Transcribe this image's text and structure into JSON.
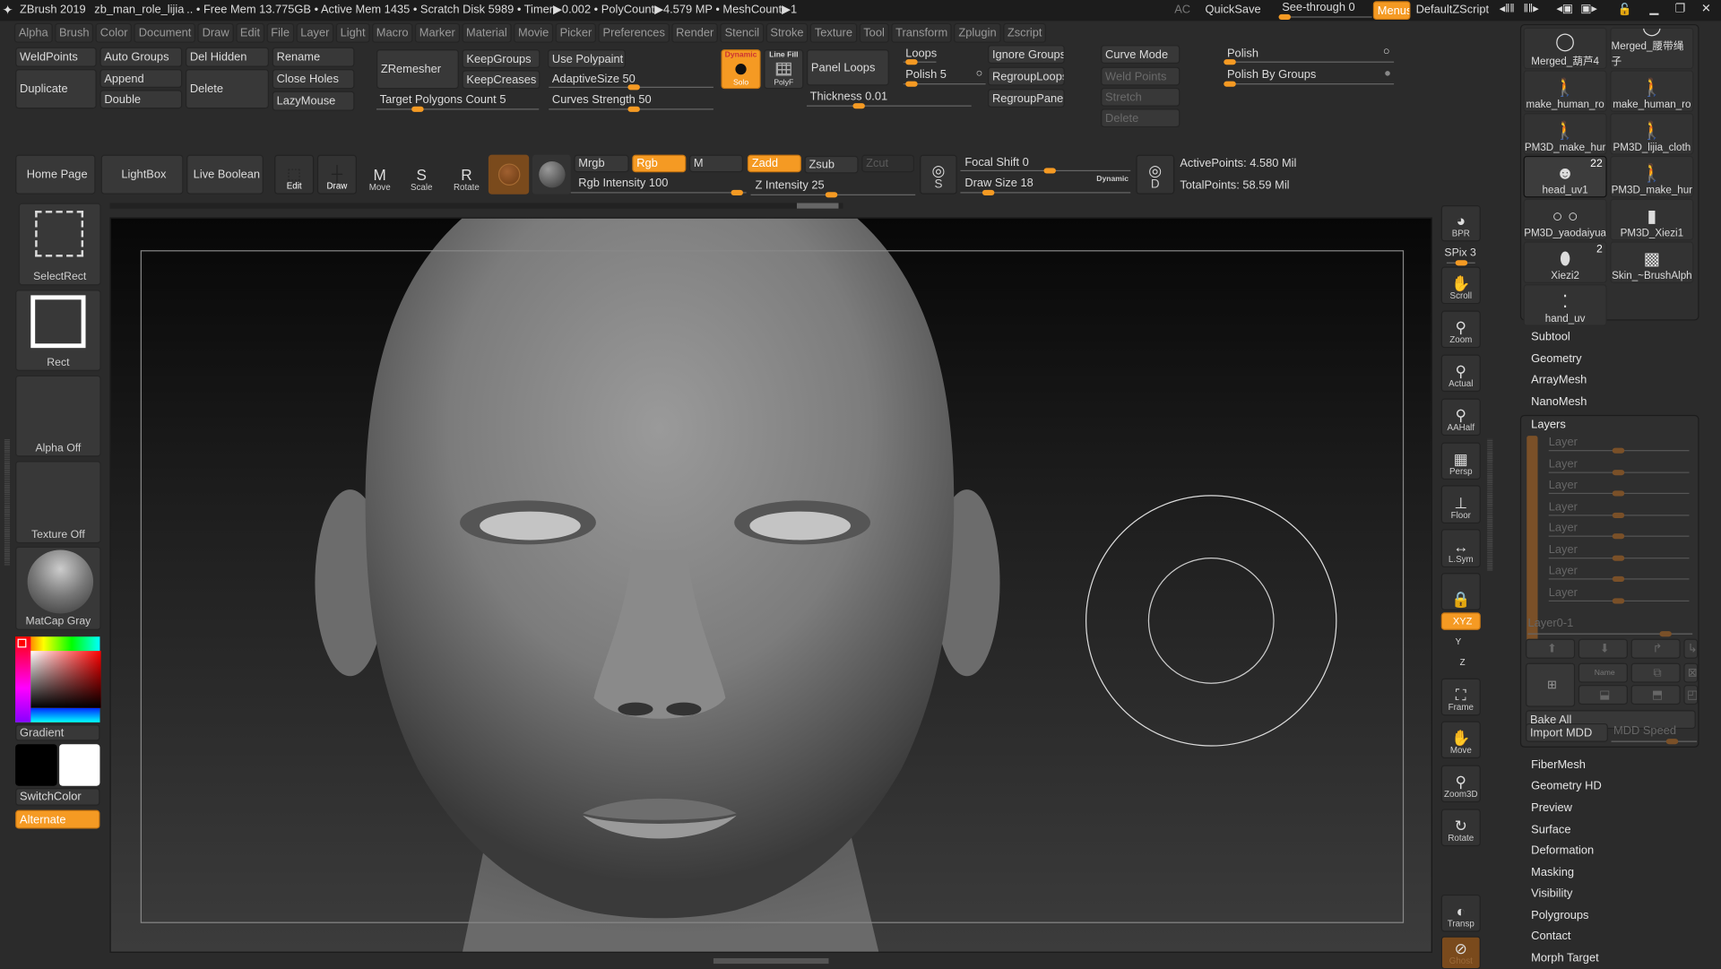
{
  "title_bar": {
    "app": "ZBrush 2019",
    "file": "zb_man_role_lijia",
    "status": ".. • Free Mem 13.775GB • Active Mem 1435 • Scratch Disk 5989 •  Timer▶0.002 • PolyCount▶4.579 MP  • MeshCount▶1",
    "ac": "AC",
    "quicksave": "QuickSave",
    "see_through": "See-through  0",
    "menus": "Menus",
    "default_zscript": "DefaultZScript"
  },
  "menu": [
    "Alpha",
    "Brush",
    "Color",
    "Document",
    "Draw",
    "Edit",
    "File",
    "Layer",
    "Light",
    "Macro",
    "Marker",
    "Material",
    "Movie",
    "Picker",
    "Preferences",
    "Render",
    "Stencil",
    "Stroke",
    "Texture",
    "Tool",
    "Transform",
    "Zplugin",
    "Zscript"
  ],
  "toolbar1": {
    "weldpoints": "WeldPoints",
    "duplicate": "Duplicate",
    "auto_groups": "Auto Groups",
    "append": "Append",
    "double": "Double",
    "del_hidden": "Del Hidden",
    "delete": "Delete",
    "rename": "Rename",
    "close_holes": "Close Holes",
    "lazymouse": "LazyMouse",
    "zremesher": "ZRemesher",
    "keepgroups": "KeepGroups",
    "keepcreases": "KeepCreases",
    "target_polygons": "Target Polygons Count 5",
    "use_polypaint": "Use Polypaint",
    "adaptive_size": "AdaptiveSize 50",
    "curves_strength": "Curves Strength 50",
    "solo_top": "Dynamic",
    "solo": "Solo",
    "linefill": "Line Fill",
    "polyf": "PolyF",
    "panel_loops": "Panel Loops",
    "loops": "Loops",
    "polish": "Polish 5",
    "thickness": "Thickness 0.01",
    "ignore_groups": "Ignore Groups",
    "regroup_loops": "RegroupLoops",
    "regroup_panels": "RegroupPanels",
    "curve_mode": "Curve Mode",
    "weld_points": "Weld Points",
    "stretch": "Stretch",
    "delete2": "Delete",
    "polish_r": "Polish",
    "polish_by_groups": "Polish By Groups"
  },
  "toolbar2": {
    "home_page": "Home Page",
    "lightbox": "LightBox",
    "live_boolean": "Live Boolean",
    "edit": "Edit",
    "draw": "Draw",
    "move": "Move",
    "scale": "Scale",
    "rotate": "Rotate",
    "mrgb": "Mrgb",
    "rgb": "Rgb",
    "m": "M",
    "zadd": "Zadd",
    "zsub": "Zsub",
    "zcut": "Zcut",
    "rgb_intensity": "Rgb Intensity 100",
    "z_intensity": "Z Intensity 25",
    "focal_shift": "Focal Shift 0",
    "draw_size": "Draw Size 18",
    "dynamic": "Dynamic",
    "s": "S",
    "d": "D",
    "active_points": "ActivePoints: 4.580 Mil",
    "total_points": "TotalPoints: 58.59 Mil"
  },
  "left_panel": {
    "select_rect": "SelectRect",
    "rect": "Rect",
    "alpha": "Alpha Off",
    "texture": "Texture Off",
    "matcap": "MatCap Gray",
    "gradient": "Gradient",
    "switch_color": "SwitchColor",
    "alternate": "Alternate",
    "main_color": "#000000",
    "secondary_color": "#ffffff"
  },
  "right_shelf": {
    "bpr": "BPR",
    "spix": "SPix 3",
    "scroll": "Scroll",
    "zoom": "Zoom",
    "actual": "Actual",
    "aahalf": "AAHalf",
    "persp_top": "Dynamic",
    "persp": "Persp",
    "floor": "Floor",
    "lsym": "L.Sym",
    "xyz": "XYZ",
    "y": "Y",
    "z": "Z",
    "frame": "Frame",
    "move": "Move",
    "zoom3d": "Zoom3D",
    "rotate": "Rotate",
    "transp": "Transp",
    "ghost": "Ghost"
  },
  "subtools": [
    {
      "name": "Merged_葫芦4",
      "icon": "ring"
    },
    {
      "name": "Merged_腰带绳子",
      "icon": "ring"
    },
    {
      "name": "make_human_ro",
      "icon": "figure"
    },
    {
      "name": "make_human_ro",
      "icon": "figure"
    },
    {
      "name": "PM3D_make_hur",
      "icon": "figure"
    },
    {
      "name": "PM3D_lijia_cloth",
      "icon": "figure"
    },
    {
      "name": "head_uv1",
      "icon": "head",
      "count": "22",
      "selected": true
    },
    {
      "name": "PM3D_make_hur",
      "icon": "figure"
    },
    {
      "name": "PM3D_yaodaiyua",
      "icon": "rings"
    },
    {
      "name": "PM3D_Xiezi1",
      "icon": "boot"
    },
    {
      "name": "Xiezi2",
      "icon": "shoe",
      "count": "2"
    },
    {
      "name": "Skin_~BrushAlph",
      "icon": "cube"
    },
    {
      "name": "hand_uv",
      "icon": "dots"
    }
  ],
  "tool_menu": {
    "top": [
      "Subtool",
      "Geometry",
      "ArrayMesh",
      "NanoMesh"
    ],
    "layers_title": "Layers",
    "layers": [
      "Layer",
      "Layer",
      "Layer",
      "Layer",
      "Layer",
      "Layer",
      "Layer",
      "Layer"
    ],
    "layer_current": "Layer0-1",
    "name": "Name",
    "bake_all": "Bake All",
    "import_mdd": "Import MDD",
    "mdd_speed": "MDD Speed",
    "bottom": [
      "FiberMesh",
      "Geometry HD",
      "Preview",
      "Surface",
      "Deformation",
      "Masking",
      "Visibility",
      "Polygroups",
      "Contact",
      "Morph Target"
    ]
  },
  "colors": {
    "accent": "#f59a23",
    "bg": "#2b2b2b",
    "button": "#383838"
  }
}
